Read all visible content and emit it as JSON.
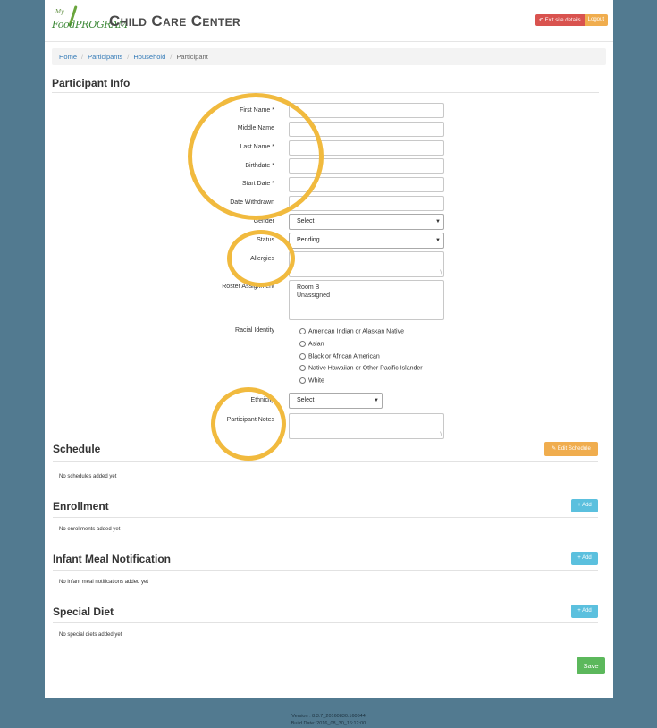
{
  "header": {
    "logo_small": "My",
    "logo_text": "FoodPROGRAM",
    "title": "Child Care Center",
    "exit_label": "Exit site details",
    "logout_label": "Logout"
  },
  "breadcrumb": [
    "Home",
    "Participants",
    "Household",
    "Participant"
  ],
  "participant_info": {
    "heading": "Participant Info",
    "labels": {
      "first_name": "First Name *",
      "middle_name": "Middle Name",
      "last_name": "Last Name *",
      "birthdate": "Birthdate *",
      "start_date": "Start Date *",
      "date_withdrawn": "Date Withdrawn",
      "gender": "Gender",
      "status": "Status",
      "allergies": "Allergies",
      "roster": "Roster Assignment",
      "racial": "Racial Identity",
      "ethnicity": "Ethnicity",
      "notes": "Participant Notes"
    },
    "gender_value": "Select",
    "status_value": "Pending",
    "roster_options": [
      "Room B",
      "Unassigned"
    ],
    "racial_options": [
      "American Indian or Alaskan Native",
      "Asian",
      "Black or African American",
      "Native Hawaiian or Other Pacific Islander",
      "White"
    ],
    "ethnicity_value": "Select"
  },
  "schedule": {
    "heading": "Schedule",
    "button": "Edit Schedule",
    "empty": "No schedules added yet"
  },
  "enrollment": {
    "heading": "Enrollment",
    "button": "+ Add",
    "empty": "No enrollments added yet"
  },
  "infant": {
    "heading": "Infant Meal Notification",
    "button": "+ Add",
    "empty": "No infant meal notifications added yet"
  },
  "diet": {
    "heading": "Special Diet",
    "button": "+ Add",
    "empty": "No special diets added yet"
  },
  "save_label": "Save",
  "footer": {
    "version": "Version : 8.3.7_20160830.160644",
    "build": "Build Date: 2016_08_30_16:12:00"
  },
  "colors": {
    "background": "#527a90",
    "highlight_ring": "#f1ba3e",
    "danger": "#d9534f",
    "warning": "#f0ad4e",
    "info": "#5bc0de",
    "success": "#5cb85c"
  }
}
